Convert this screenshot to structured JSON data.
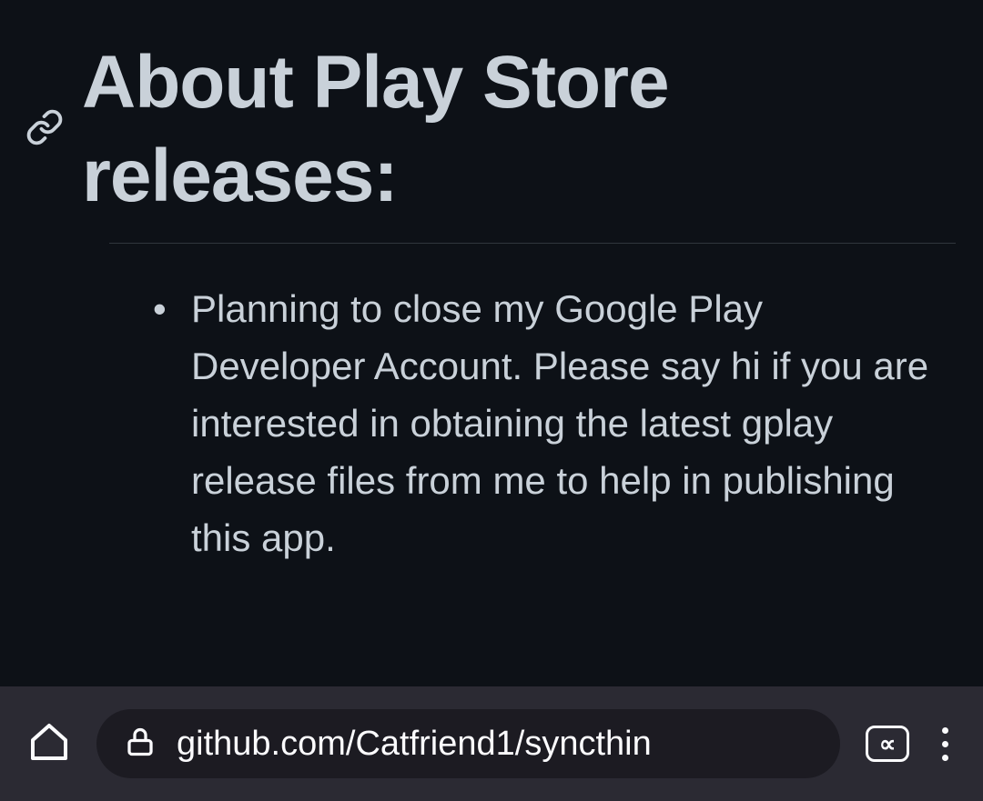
{
  "heading": "About Play Store releases:",
  "bullets": [
    "Planning to close my Google Play Developer Account. Please say hi if you are interested in obtaining the latest gplay release files from me to help in publishing this app."
  ],
  "browser": {
    "url": "github.com/Catfriend1/syncthin",
    "tabsIndicator": "∝"
  }
}
